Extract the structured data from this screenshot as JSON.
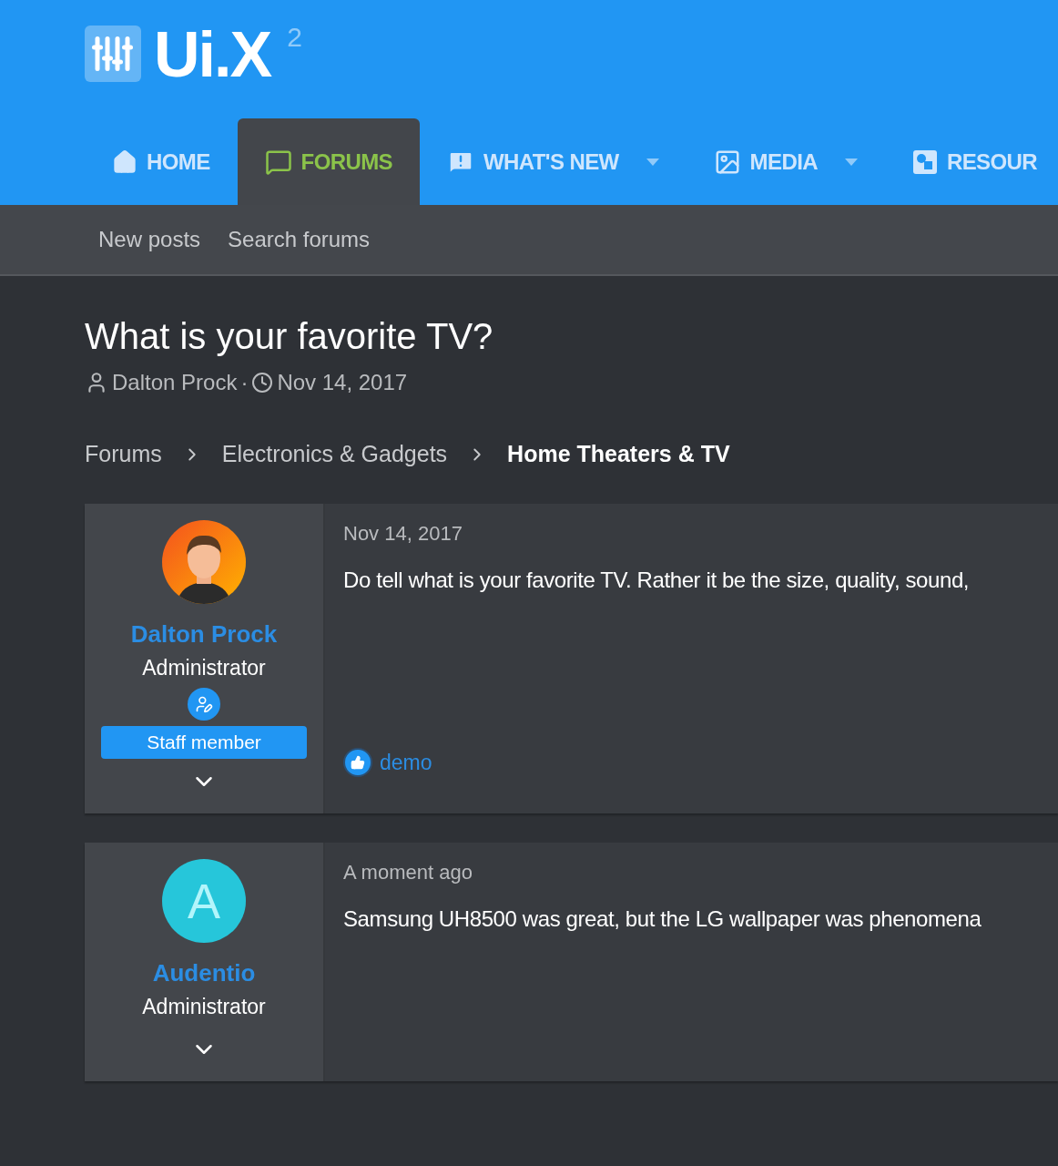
{
  "logo": {
    "text": "Ui.X",
    "superscript": "2"
  },
  "nav": [
    {
      "label": "HOME",
      "kind": "home",
      "selected": false,
      "dropdown": false
    },
    {
      "label": "FORUMS",
      "kind": "forums",
      "selected": true,
      "dropdown": false
    },
    {
      "label": "WHAT'S NEW",
      "kind": "new",
      "selected": false,
      "dropdown": true
    },
    {
      "label": "MEDIA",
      "kind": "media",
      "selected": false,
      "dropdown": true
    },
    {
      "label": "RESOUR",
      "kind": "resources",
      "selected": false,
      "dropdown": false
    }
  ],
  "subnav": [
    "New posts",
    "Search forums"
  ],
  "thread": {
    "title": "What is your favorite TV?",
    "author": "Dalton Prock",
    "separator": "·",
    "date": "Nov 14, 2017"
  },
  "breadcrumbs": [
    {
      "label": "Forums",
      "current": false
    },
    {
      "label": "Electronics & Gadgets",
      "current": false
    },
    {
      "label": "Home Theaters & TV",
      "current": true
    }
  ],
  "posts": [
    {
      "author": "Dalton Prock",
      "role": "Administrator",
      "staff": "Staff member",
      "date": "Nov 14, 2017",
      "body": "Do tell what is your favorite TV. Rather it be the size, quality, sound,",
      "reaction": "demo"
    },
    {
      "author": "Audentio",
      "role": "Administrator",
      "avatar": {
        "kind": "letter",
        "letter": "A"
      },
      "date": "A moment ago",
      "body": "Samsung UH8500 was great, but the LG wallpaper was phenomena"
    }
  ]
}
